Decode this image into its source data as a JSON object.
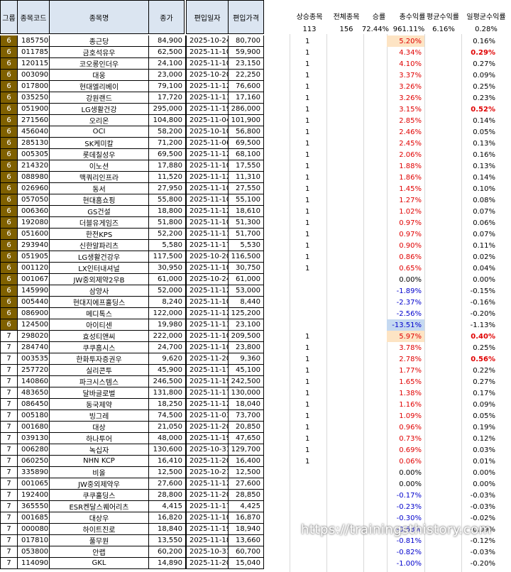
{
  "headers": {
    "group": "그룹",
    "code": "종목코드",
    "name": "종목명",
    "close": "종가",
    "date": "편입일자",
    "price": "편입가격"
  },
  "summary_headers": {
    "up": "상승종목",
    "total": "전체종목",
    "winrate": "승률",
    "total_return": "총수익률",
    "avg_return": "평균수익률",
    "daily_avg": "일평균수익률"
  },
  "summary_values": {
    "up": "113",
    "total": "156",
    "winrate": "72.44%",
    "total_return": "961.11%",
    "avg_return": "6.16%",
    "daily_avg": "0.28%"
  },
  "rows": [
    {
      "g": "6",
      "code": "185750",
      "name": "종근당",
      "close": "84,900",
      "date": "2025-10-24",
      "price": "80,700",
      "up": "1",
      "ret": "5.20%",
      "daily": "0.16%"
    },
    {
      "g": "6",
      "code": "011785",
      "name": "금호석유우",
      "close": "62,500",
      "date": "2025-11-10",
      "price": "59,900",
      "up": "1",
      "ret": "4.34%",
      "daily": "0.29%"
    },
    {
      "g": "6",
      "code": "120115",
      "name": "코오롱인더우",
      "close": "24,100",
      "date": "2025-11-10",
      "price": "23,150",
      "up": "1",
      "ret": "4.10%",
      "daily": "0.27%"
    },
    {
      "g": "6",
      "code": "003090",
      "name": "대웅",
      "close": "23,000",
      "date": "2025-10-20",
      "price": "22,250",
      "up": "1",
      "ret": "3.37%",
      "daily": "0.09%"
    },
    {
      "g": "6",
      "code": "017800",
      "name": "현대엘리베이",
      "close": "79,100",
      "date": "2025-11-12",
      "price": "76,600",
      "up": "1",
      "ret": "3.26%",
      "daily": "0.25%"
    },
    {
      "g": "6",
      "code": "035250",
      "name": "강원랜드",
      "close": "17,720",
      "date": "2025-11-11",
      "price": "17,160",
      "up": "1",
      "ret": "3.26%",
      "daily": "0.23%"
    },
    {
      "g": "6",
      "code": "051900",
      "name": "LG생활건강",
      "close": "295,000",
      "date": "2025-11-19",
      "price": "286,000",
      "up": "1",
      "ret": "3.15%",
      "daily": "0.52%"
    },
    {
      "g": "6",
      "code": "271560",
      "name": "오리온",
      "close": "104,800",
      "date": "2025-11-04",
      "price": "101,900",
      "up": "1",
      "ret": "2.85%",
      "daily": "0.14%"
    },
    {
      "g": "6",
      "code": "456040",
      "name": "OCI",
      "close": "58,200",
      "date": "2025-10-10",
      "price": "56,800",
      "up": "1",
      "ret": "2.46%",
      "daily": "0.05%"
    },
    {
      "g": "6",
      "code": "285130",
      "name": "SK케미칼",
      "close": "71,200",
      "date": "2025-11-06",
      "price": "69,500",
      "up": "1",
      "ret": "2.45%",
      "daily": "0.13%"
    },
    {
      "g": "6",
      "code": "005305",
      "name": "롯데칠성우",
      "close": "69,500",
      "date": "2025-11-12",
      "price": "68,100",
      "up": "1",
      "ret": "2.06%",
      "daily": "0.16%"
    },
    {
      "g": "6",
      "code": "214320",
      "name": "이노션",
      "close": "17,880",
      "date": "2025-11-10",
      "price": "17,550",
      "up": "1",
      "ret": "1.88%",
      "daily": "0.13%"
    },
    {
      "g": "6",
      "code": "088980",
      "name": "맥쿼리인프라",
      "close": "11,520",
      "date": "2025-11-12",
      "price": "11,310",
      "up": "1",
      "ret": "1.86%",
      "daily": "0.14%"
    },
    {
      "g": "6",
      "code": "026960",
      "name": "동서",
      "close": "27,950",
      "date": "2025-11-10",
      "price": "27,550",
      "up": "1",
      "ret": "1.45%",
      "daily": "0.10%"
    },
    {
      "g": "6",
      "code": "057050",
      "name": "현대홈쇼핑",
      "close": "55,800",
      "date": "2025-11-10",
      "price": "55,100",
      "up": "1",
      "ret": "1.27%",
      "daily": "0.08%"
    },
    {
      "g": "6",
      "code": "006360",
      "name": "GS건설",
      "close": "18,800",
      "date": "2025-11-12",
      "price": "18,610",
      "up": "1",
      "ret": "1.02%",
      "daily": "0.07%"
    },
    {
      "g": "6",
      "code": "192080",
      "name": "더블유게임즈",
      "close": "51,800",
      "date": "2025-11-10",
      "price": "51,300",
      "up": "1",
      "ret": "0.97%",
      "daily": "0.06%"
    },
    {
      "g": "6",
      "code": "051600",
      "name": "한전KPS",
      "close": "52,200",
      "date": "2025-11-11",
      "price": "51,700",
      "up": "1",
      "ret": "0.97%",
      "daily": "0.07%"
    },
    {
      "g": "6",
      "code": "293940",
      "name": "신한알파리츠",
      "close": "5,580",
      "date": "2025-11-17",
      "price": "5,530",
      "up": "1",
      "ret": "0.90%",
      "daily": "0.11%"
    },
    {
      "g": "6",
      "code": "051905",
      "name": "LG생활건강우",
      "close": "117,500",
      "date": "2025-10-20",
      "price": "116,500",
      "up": "1",
      "ret": "0.86%",
      "daily": "0.02%"
    },
    {
      "g": "6",
      "code": "001120",
      "name": "LX인터내셔널",
      "close": "30,950",
      "date": "2025-11-10",
      "price": "30,750",
      "up": "1",
      "ret": "0.65%",
      "daily": "0.04%"
    },
    {
      "g": "6",
      "code": "001067",
      "name": "JW중외제약2우B",
      "close": "61,000",
      "date": "2025-10-24",
      "price": "61,000",
      "up": "",
      "ret": "0.00%",
      "daily": "0.00%"
    },
    {
      "g": "6",
      "code": "145990",
      "name": "삼양사",
      "close": "52,000",
      "date": "2025-11-12",
      "price": "53,000",
      "up": "",
      "ret": "-1.89%",
      "daily": "-0.15%"
    },
    {
      "g": "6",
      "code": "005440",
      "name": "현대지에프홀딩스",
      "close": "8,240",
      "date": "2025-11-10",
      "price": "8,440",
      "up": "",
      "ret": "-2.37%",
      "daily": "-0.16%"
    },
    {
      "g": "6",
      "code": "086900",
      "name": "메디톡스",
      "close": "122,000",
      "date": "2025-11-12",
      "price": "125,200",
      "up": "",
      "ret": "-2.56%",
      "daily": "-0.20%"
    },
    {
      "g": "6",
      "code": "124500",
      "name": "아이티센",
      "close": "19,980",
      "date": "2025-11-13",
      "price": "23,100",
      "up": "",
      "ret": "-13.51%",
      "daily": "-1.13%"
    },
    {
      "g": "7",
      "code": "298020",
      "name": "효성티앤씨",
      "close": "222,000",
      "date": "2025-11-10",
      "price": "209,500",
      "up": "1",
      "ret": "5.97%",
      "daily": "0.40%"
    },
    {
      "g": "7",
      "code": "284740",
      "name": "쿠쿠홈시스",
      "close": "24,700",
      "date": "2025-11-10",
      "price": "23,800",
      "up": "1",
      "ret": "3.78%",
      "daily": "0.25%"
    },
    {
      "g": "7",
      "code": "003535",
      "name": "한화투자증권우",
      "close": "9,620",
      "date": "2025-11-20",
      "price": "9,360",
      "up": "1",
      "ret": "2.78%",
      "daily": "0.56%"
    },
    {
      "g": "7",
      "code": "257720",
      "name": "실리콘투",
      "close": "45,900",
      "date": "2025-11-17",
      "price": "45,100",
      "up": "1",
      "ret": "1.77%",
      "daily": "0.22%"
    },
    {
      "g": "7",
      "code": "140860",
      "name": "파크시스템스",
      "close": "246,500",
      "date": "2025-11-19",
      "price": "242,500",
      "up": "1",
      "ret": "1.65%",
      "daily": "0.27%"
    },
    {
      "g": "7",
      "code": "483650",
      "name": "달바글로벌",
      "close": "131,800",
      "date": "2025-11-17",
      "price": "130,000",
      "up": "1",
      "ret": "1.38%",
      "daily": "0.17%"
    },
    {
      "g": "7",
      "code": "086450",
      "name": "동국제약",
      "close": "18,250",
      "date": "2025-11-12",
      "price": "18,040",
      "up": "1",
      "ret": "1.16%",
      "daily": "0.09%"
    },
    {
      "g": "7",
      "code": "005180",
      "name": "빙그레",
      "close": "74,500",
      "date": "2025-11-03",
      "price": "73,700",
      "up": "1",
      "ret": "1.09%",
      "daily": "0.05%"
    },
    {
      "g": "7",
      "code": "001680",
      "name": "대상",
      "close": "21,050",
      "date": "2025-11-20",
      "price": "20,850",
      "up": "1",
      "ret": "0.96%",
      "daily": "0.19%"
    },
    {
      "g": "7",
      "code": "039130",
      "name": "하나투어",
      "close": "48,000",
      "date": "2025-11-19",
      "price": "47,650",
      "up": "1",
      "ret": "0.73%",
      "daily": "0.12%"
    },
    {
      "g": "7",
      "code": "006280",
      "name": "녹십자",
      "close": "130,600",
      "date": "2025-10-31",
      "price": "129,700",
      "up": "1",
      "ret": "0.69%",
      "daily": "0.03%"
    },
    {
      "g": "7",
      "code": "060250",
      "name": "NHN KCP",
      "close": "16,410",
      "date": "2025-11-20",
      "price": "16,400",
      "up": "1",
      "ret": "0.06%",
      "daily": "0.01%"
    },
    {
      "g": "7",
      "code": "335890",
      "name": "비올",
      "close": "12,500",
      "date": "2025-10-21",
      "price": "12,500",
      "up": "",
      "ret": "0.00%",
      "daily": "0.00%"
    },
    {
      "g": "7",
      "code": "001065",
      "name": "JW중외제약우",
      "close": "27,600",
      "date": "2025-11-12",
      "price": "27,600",
      "up": "",
      "ret": "0.00%",
      "daily": "0.00%"
    },
    {
      "g": "7",
      "code": "192400",
      "name": "쿠쿠홀딩스",
      "close": "28,800",
      "date": "2025-11-20",
      "price": "28,850",
      "up": "",
      "ret": "-0.17%",
      "daily": "-0.03%"
    },
    {
      "g": "7",
      "code": "365550",
      "name": "ESR켄달스퀘어리츠",
      "close": "4,415",
      "date": "2025-11-17",
      "price": "4,425",
      "up": "",
      "ret": "-0.23%",
      "daily": "-0.03%"
    },
    {
      "g": "7",
      "code": "001685",
      "name": "대상우",
      "close": "16,820",
      "date": "2025-11-10",
      "price": "16,870",
      "up": "",
      "ret": "-0.30%",
      "daily": "-0.02%"
    },
    {
      "g": "7",
      "code": "000080",
      "name": "하이트진로",
      "close": "18,840",
      "date": "2025-11-19",
      "price": "18,940",
      "up": "",
      "ret": "-0.53%",
      "daily": "-0.09%"
    },
    {
      "g": "7",
      "code": "017810",
      "name": "풀무원",
      "close": "13,550",
      "date": "2025-11-18",
      "price": "13,660",
      "up": "",
      "ret": "-0.81%",
      "daily": "-0.12%"
    },
    {
      "g": "7",
      "code": "053800",
      "name": "안랩",
      "close": "60,200",
      "date": "2025-10-31",
      "price": "60,700",
      "up": "",
      "ret": "-0.82%",
      "daily": "-0.03%"
    },
    {
      "g": "7",
      "code": "114090",
      "name": "GKL",
      "close": "14,890",
      "date": "2025-11-20",
      "price": "15,040",
      "up": "",
      "ret": "-1.00%",
      "daily": "-0.20%"
    }
  ],
  "highlights": {
    "orange_rows": [
      0,
      26
    ],
    "blue_rows": [
      25
    ],
    "bold_daily_rows": [
      1,
      6,
      26,
      28
    ]
  },
  "colors": {
    "group6_bg": "#7f6000",
    "header_bg": "#dbe5f1",
    "positive": "#e00000",
    "negative": "#0000cc",
    "highlight_orange": "#fde4c4",
    "highlight_blue": "#c5d9f1"
  },
  "watermark": "https://trainingsthistory.com"
}
